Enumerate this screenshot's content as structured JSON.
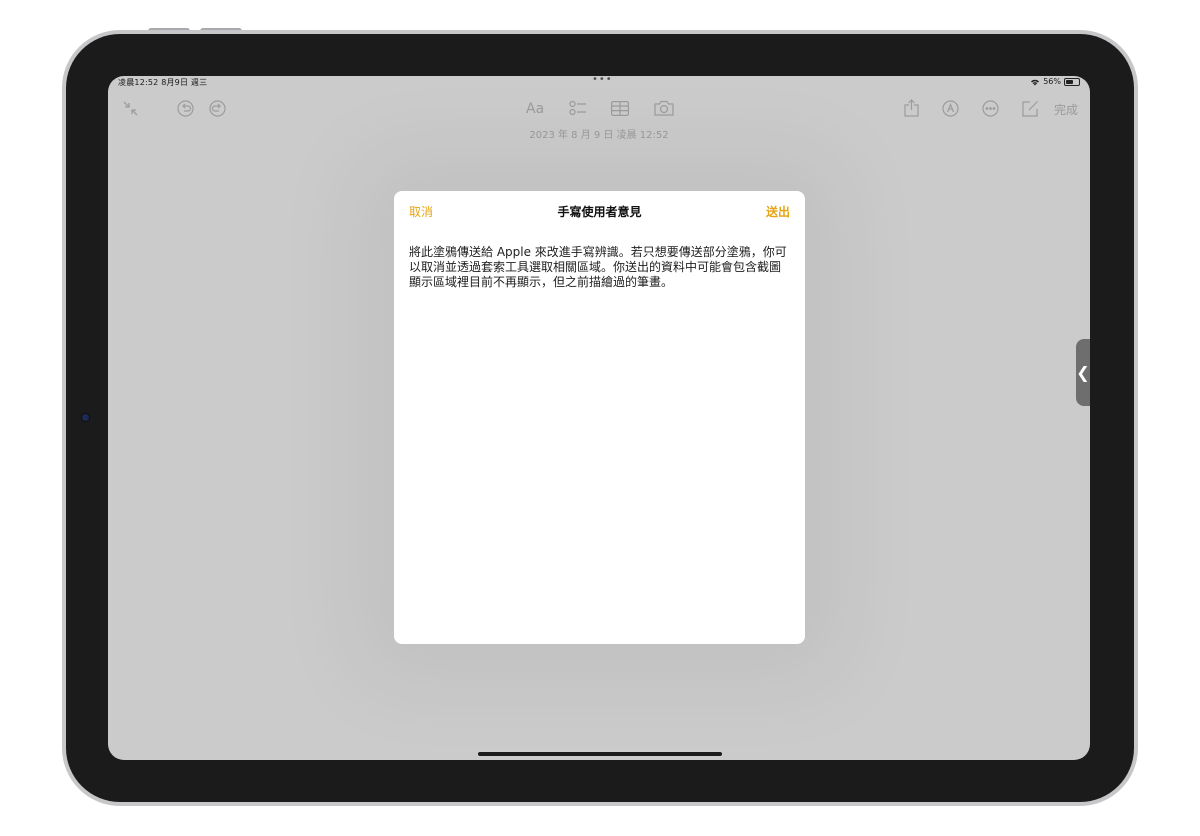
{
  "status_bar": {
    "time_date": "凌晨12:52  8月9日 週三",
    "dots": "•••",
    "battery_percent": "56%",
    "battery_level": 0.56
  },
  "toolbar": {
    "left_icons": [
      "collapse-icon",
      "undo-icon",
      "redo-icon"
    ],
    "center_icons": [
      "text-format-icon",
      "checklist-icon",
      "table-icon",
      "camera-icon"
    ],
    "text_format_label": "Aa",
    "right_icons": [
      "share-icon",
      "markup-icon",
      "more-icon",
      "compose-icon"
    ],
    "done_label": "完成"
  },
  "note": {
    "date": "2023 年 8 月 9 日 凌晨 12:52"
  },
  "modal": {
    "cancel_label": "取消",
    "title": "手寫使用者意見",
    "send_label": "送出",
    "body": "將此塗鴉傳送給 Apple 來改進手寫辨識。若只想要傳送部分塗鴉，你可以取消並透過套索工具選取相關區域。你送出的資料中可能會包含截圖顯示區域裡目前不再顯示，但之前描繪過的筆畫。"
  },
  "side_handle": {
    "icon": "chevron-left-icon",
    "glyph": "❮"
  },
  "colors": {
    "accent": "#e7a412",
    "dimmed_background": "#cbcbcb",
    "modal_background": "#ffffff",
    "bezel": "#1b1b1c"
  }
}
